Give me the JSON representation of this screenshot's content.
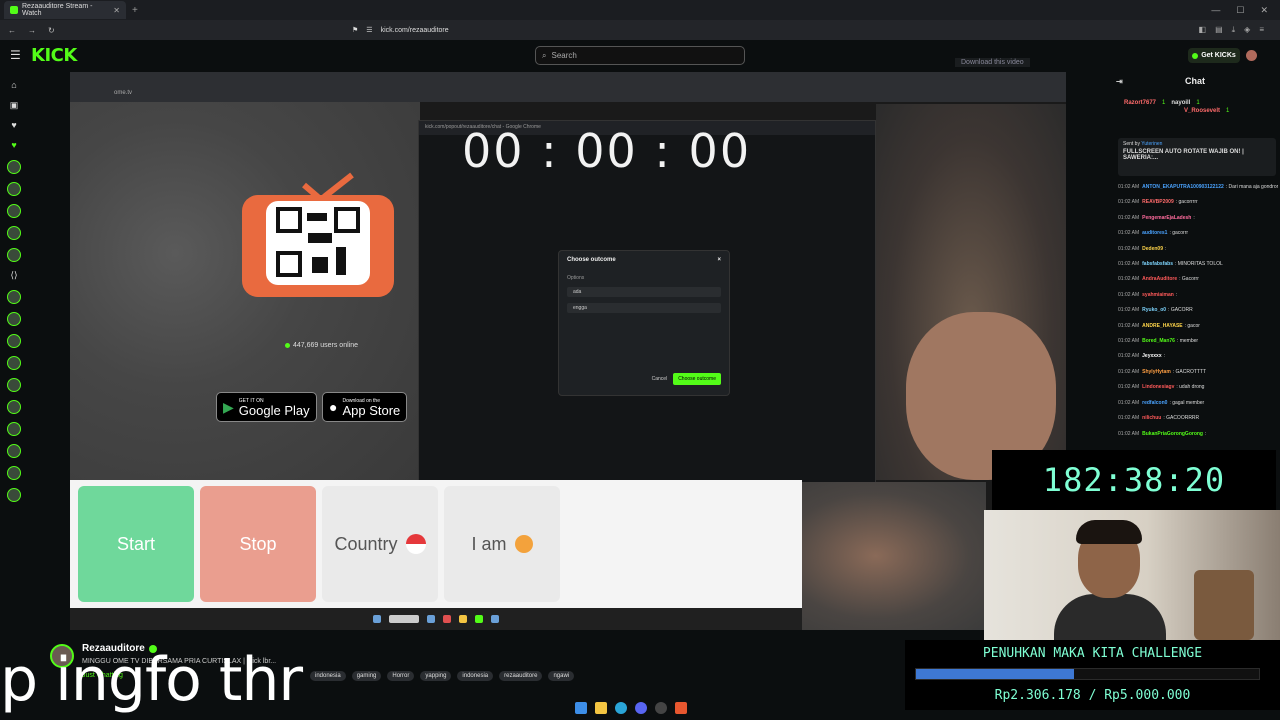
{
  "browser": {
    "tab_title": "Rezaauditore Stream - Watch",
    "url": "kick.com/rezaauditore",
    "new_tab": "+",
    "close": "✕",
    "win_min": "—",
    "win_max": "☐",
    "win_close": "✕"
  },
  "kick": {
    "logo": "KICK",
    "search_placeholder": "Search",
    "get_kicks": "Get KICKs",
    "download_video": "Download this video"
  },
  "inner_window": {
    "url": "ome.tv",
    "users_online": "447,669 users online",
    "google_play_small": "GET IT ON",
    "google_play": "Google Play",
    "app_store_small": "Download on the",
    "app_store": "App Store",
    "popup_url": "kick.com/popout/rezaauditore/chat - Google Chrome",
    "popup_timer": "00 : 00 : 00",
    "modal_title": "Choose outcome",
    "modal_close": "×",
    "modal_options_label": "Options",
    "option_1": "ada",
    "option_2": "engga",
    "modal_cancel": "Cancel",
    "modal_confirm": "Choose outcome",
    "btn_start": "Start",
    "btn_stop": "Stop",
    "btn_country": "Country",
    "btn_iam": "I am"
  },
  "timer": "182:38:20",
  "chat": {
    "title": "Chat",
    "pinned": {
      "user1": "Razort7677",
      "count1": "1",
      "user2": "nayoill",
      "count2": "1",
      "user3": "V_Roosevelt",
      "count3": "1"
    },
    "sent_by_label": "Sent by",
    "sent_by": "Yuterinen",
    "sent_message": "FULLSCREEN AUTO ROTATE WAJIB ON! | SAWERIA:...",
    "messages": [
      {
        "time": "01:02 AM",
        "user": "ANTON_EKAPUTRA100903122122",
        "text": ": Dari mana aja gondrong kontol",
        "color": "#4aa3ff"
      },
      {
        "time": "01:02 AM",
        "user": "REAVBP2009",
        "text": ": gacorrrrr",
        "color": "#ff6b6b"
      },
      {
        "time": "01:02 AM",
        "user": "PengemarEjaLadesh",
        "text": ":",
        "color": "#ff6b9d"
      },
      {
        "time": "01:02 AM",
        "user": "auditores1",
        "text": ": gacorrr",
        "color": "#4aa3ff"
      },
      {
        "time": "01:02 AM",
        "user": "Deden09",
        "text": ":",
        "color": "#ffd54a"
      },
      {
        "time": "01:02 AM",
        "user": "fabsfabsfabs",
        "text": ": MINORITAS TOLOL",
        "color": "#7dd3fc"
      },
      {
        "time": "01:02 AM",
        "user": "AndraAuditore",
        "text": ": Gacorrr",
        "color": "#ff5a5a"
      },
      {
        "time": "01:02 AM",
        "user": "syahmiaiman",
        "text": ":",
        "color": "#ff5a5a"
      },
      {
        "time": "01:02 AM",
        "user": "Ryuko_o0",
        "text": ": GACORR",
        "color": "#7dd3fc"
      },
      {
        "time": "01:02 AM",
        "user": "ANDRE_HAYASE",
        "text": ": gacor",
        "color": "#ffd54a"
      },
      {
        "time": "01:02 AM",
        "user": "Bored_Man76",
        "text": ": member",
        "color": "#53fc18"
      },
      {
        "time": "01:02 AM",
        "user": "Jeyxxxx",
        "text": ":",
        "color": "#ffffff"
      },
      {
        "time": "01:02 AM",
        "user": "ShylyHytam",
        "text": ": GACROTTTT",
        "color": "#ff9f43"
      },
      {
        "time": "01:02 AM",
        "user": "Lindonesiagv",
        "text": ": udah drong",
        "color": "#ff5a5a"
      },
      {
        "time": "01:02 AM",
        "user": "redfalcon0",
        "text": ": gagal member",
        "color": "#4aa3ff"
      },
      {
        "time": "01:02 AM",
        "user": "nilichuu",
        "text": ": GACOORRRR",
        "color": "#ff5a5a"
      },
      {
        "time": "01:02 AM",
        "user": "BukanPriaGorongGorong",
        "text": ":",
        "color": "#53fc18"
      }
    ]
  },
  "challenge": {
    "title": "PENUHKAN MAKA KITA CHALLENGE",
    "progress_text": "Rp2.306.178 / Rp5.000.000",
    "fraction": 0.461
  },
  "stream_info": {
    "streamer": "Rezaauditore",
    "title": "MINGGU OME TV DIBERSAMA PRIA CURTISLAX | !kick lbr...",
    "category": "Just Chatting",
    "tags": [
      "indonesia",
      "gaming",
      "Horror",
      "yapping",
      "indonesia",
      "rezaauditore",
      "ngawi"
    ]
  },
  "caption": "p ingfo thr"
}
